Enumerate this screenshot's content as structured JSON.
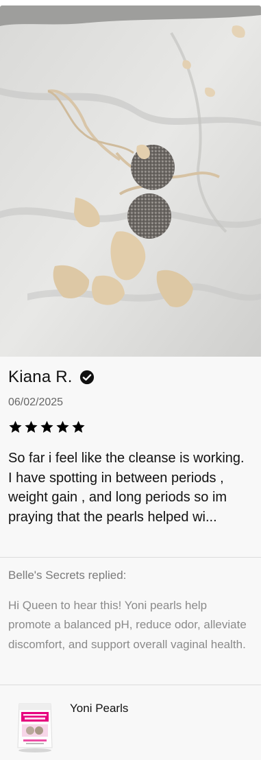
{
  "review": {
    "photo_icon": "review-photo",
    "reviewer_name": "Kiana R.",
    "verified_icon": "check-badge-icon",
    "date": "06/02/2025",
    "rating": 5,
    "rating_max": 5,
    "body": "So far i feel like the cleanse is working. I have spotting in between periods , weight gain , and long periods so im praying that the pearls helped wi..."
  },
  "reply": {
    "label": "Belle's Secrets replied:",
    "body": "Hi Queen to hear this! Yoni pearls help promote a balanced pH, reduce odor, alleviate discomfort, and support overall vaginal health."
  },
  "product": {
    "name": "Yoni Pearls",
    "thumbnail_icon": "product-package-thumbnail",
    "accent_color": "#e6007e"
  },
  "colors": {
    "card_background": "#f8f8f8",
    "text_primary": "#111111",
    "text_secondary": "#8a8a8a"
  }
}
